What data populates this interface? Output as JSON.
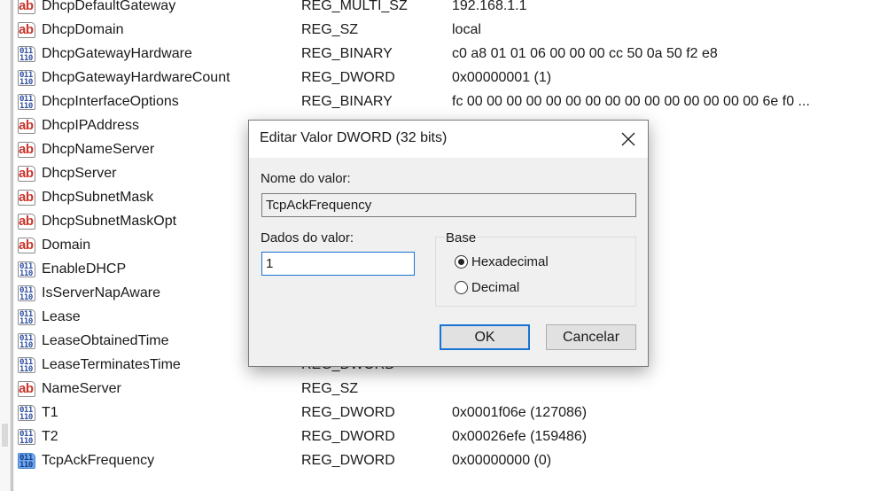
{
  "registry_list": {
    "rows": [
      {
        "name": "DhcpDefaultGateway",
        "icon": "string-value-icon",
        "type": "REG_MULTI_SZ",
        "data": "192.168.1.1"
      },
      {
        "name": "DhcpDomain",
        "icon": "string-value-icon",
        "type": "REG_SZ",
        "data": "local"
      },
      {
        "name": "DhcpGatewayHardware",
        "icon": "binary-value-icon",
        "type": "REG_BINARY",
        "data": "c0 a8 01 01 06 00 00 00 cc 50 0a 50 f2 e8"
      },
      {
        "name": "DhcpGatewayHardwareCount",
        "icon": "binary-value-icon",
        "type": "REG_DWORD",
        "data": "0x00000001 (1)"
      },
      {
        "name": "DhcpInterfaceOptions",
        "icon": "binary-value-icon",
        "type": "REG_BINARY",
        "data": "fc 00 00 00 00 00 00 00 00 00 00 00 00 00 00 00 6e f0 ..."
      },
      {
        "name": "DhcpIPAddress",
        "icon": "string-value-icon",
        "type": "",
        "data": ""
      },
      {
        "name": "DhcpNameServer",
        "icon": "string-value-icon",
        "type": "",
        "data": ""
      },
      {
        "name": "DhcpServer",
        "icon": "string-value-icon",
        "type": "",
        "data": ""
      },
      {
        "name": "DhcpSubnetMask",
        "icon": "string-value-icon",
        "type": "",
        "data": ""
      },
      {
        "name": "DhcpSubnetMaskOpt",
        "icon": "string-value-icon",
        "type": "",
        "data": ""
      },
      {
        "name": "Domain",
        "icon": "string-value-icon",
        "type": "",
        "data": ""
      },
      {
        "name": "EnableDHCP",
        "icon": "binary-value-icon",
        "type": "",
        "data": ""
      },
      {
        "name": "IsServerNapAware",
        "icon": "binary-value-icon",
        "type": "",
        "data": ""
      },
      {
        "name": "Lease",
        "icon": "binary-value-icon",
        "type": "",
        "data": ""
      },
      {
        "name": "LeaseObtainedTime",
        "icon": "binary-value-icon",
        "type": "",
        "data": ""
      },
      {
        "name": "LeaseTerminatesTime",
        "icon": "binary-value-icon",
        "type": "REG_DWORD",
        "data": ""
      },
      {
        "name": "NameServer",
        "icon": "string-value-icon",
        "type": "REG_SZ",
        "data": ""
      },
      {
        "name": "T1",
        "icon": "binary-value-icon",
        "type": "REG_DWORD",
        "data": "0x0001f06e (127086)"
      },
      {
        "name": "T2",
        "icon": "binary-value-icon",
        "type": "REG_DWORD",
        "data": "0x00026efe (159486)"
      },
      {
        "name": "TcpAckFrequency",
        "icon": "binary-value-icon",
        "type": "REG_DWORD",
        "data": "0x00000000 (0)",
        "selected": true
      }
    ]
  },
  "dialog": {
    "title": "Editar Valor DWORD (32 bits)",
    "close_icon": "close-icon",
    "value_name_label": "Nome do valor:",
    "value_name": "TcpAckFrequency",
    "value_data_label": "Dados do valor:",
    "value_data": "1",
    "base_label": "Base",
    "base_options": [
      {
        "label": "Hexadecimal",
        "selected": true
      },
      {
        "label": "Decimal",
        "selected": false
      }
    ],
    "ok_label": "OK",
    "cancel_label": "Cancelar"
  }
}
